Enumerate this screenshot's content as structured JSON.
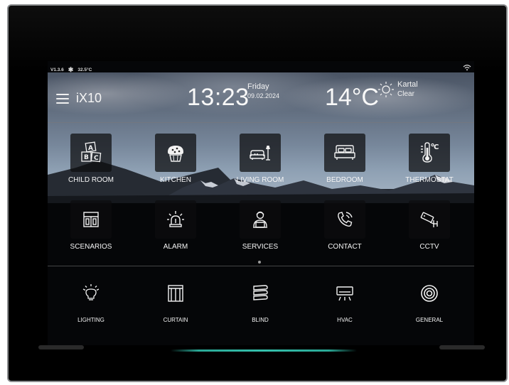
{
  "status": {
    "version": "V1.3.6",
    "cpu_temp": "32.5°C"
  },
  "header": {
    "brand": "iX10",
    "time": "13:23",
    "day": "Friday",
    "date": "09.02.2024",
    "temperature": "14°C",
    "city": "Kartal",
    "condition": "Clear"
  },
  "rooms": [
    {
      "label": "CHILD ROOM",
      "icon": "abc-blocks-icon"
    },
    {
      "label": "KITCHEN",
      "icon": "muffin-icon"
    },
    {
      "label": "LIVING ROOM",
      "icon": "sofa-lamp-icon"
    },
    {
      "label": "BEDROOM",
      "icon": "bed-icon"
    },
    {
      "label": "THERMOSTAT",
      "icon": "thermometer-icon"
    }
  ],
  "functions": [
    {
      "label": "SCENARIOS",
      "icon": "scenarios-layout-icon"
    },
    {
      "label": "ALARM",
      "icon": "alarm-light-icon"
    },
    {
      "label": "SERVICES",
      "icon": "service-person-icon"
    },
    {
      "label": "CONTACT",
      "icon": "phone-call-icon"
    },
    {
      "label": "CCTV",
      "icon": "security-camera-icon"
    }
  ],
  "devices": [
    {
      "label": "LIGHTING",
      "icon": "light-bulb-icon"
    },
    {
      "label": "CURTAIN",
      "icon": "curtain-icon"
    },
    {
      "label": "BLIND",
      "icon": "blind-icon"
    },
    {
      "label": "HVAC",
      "icon": "air-conditioner-icon"
    },
    {
      "label": "GENERAL",
      "icon": "concentric-circles-icon"
    }
  ],
  "colors": {
    "led_accent": "#2aa896",
    "icon_stroke": "#f2f2f2"
  }
}
